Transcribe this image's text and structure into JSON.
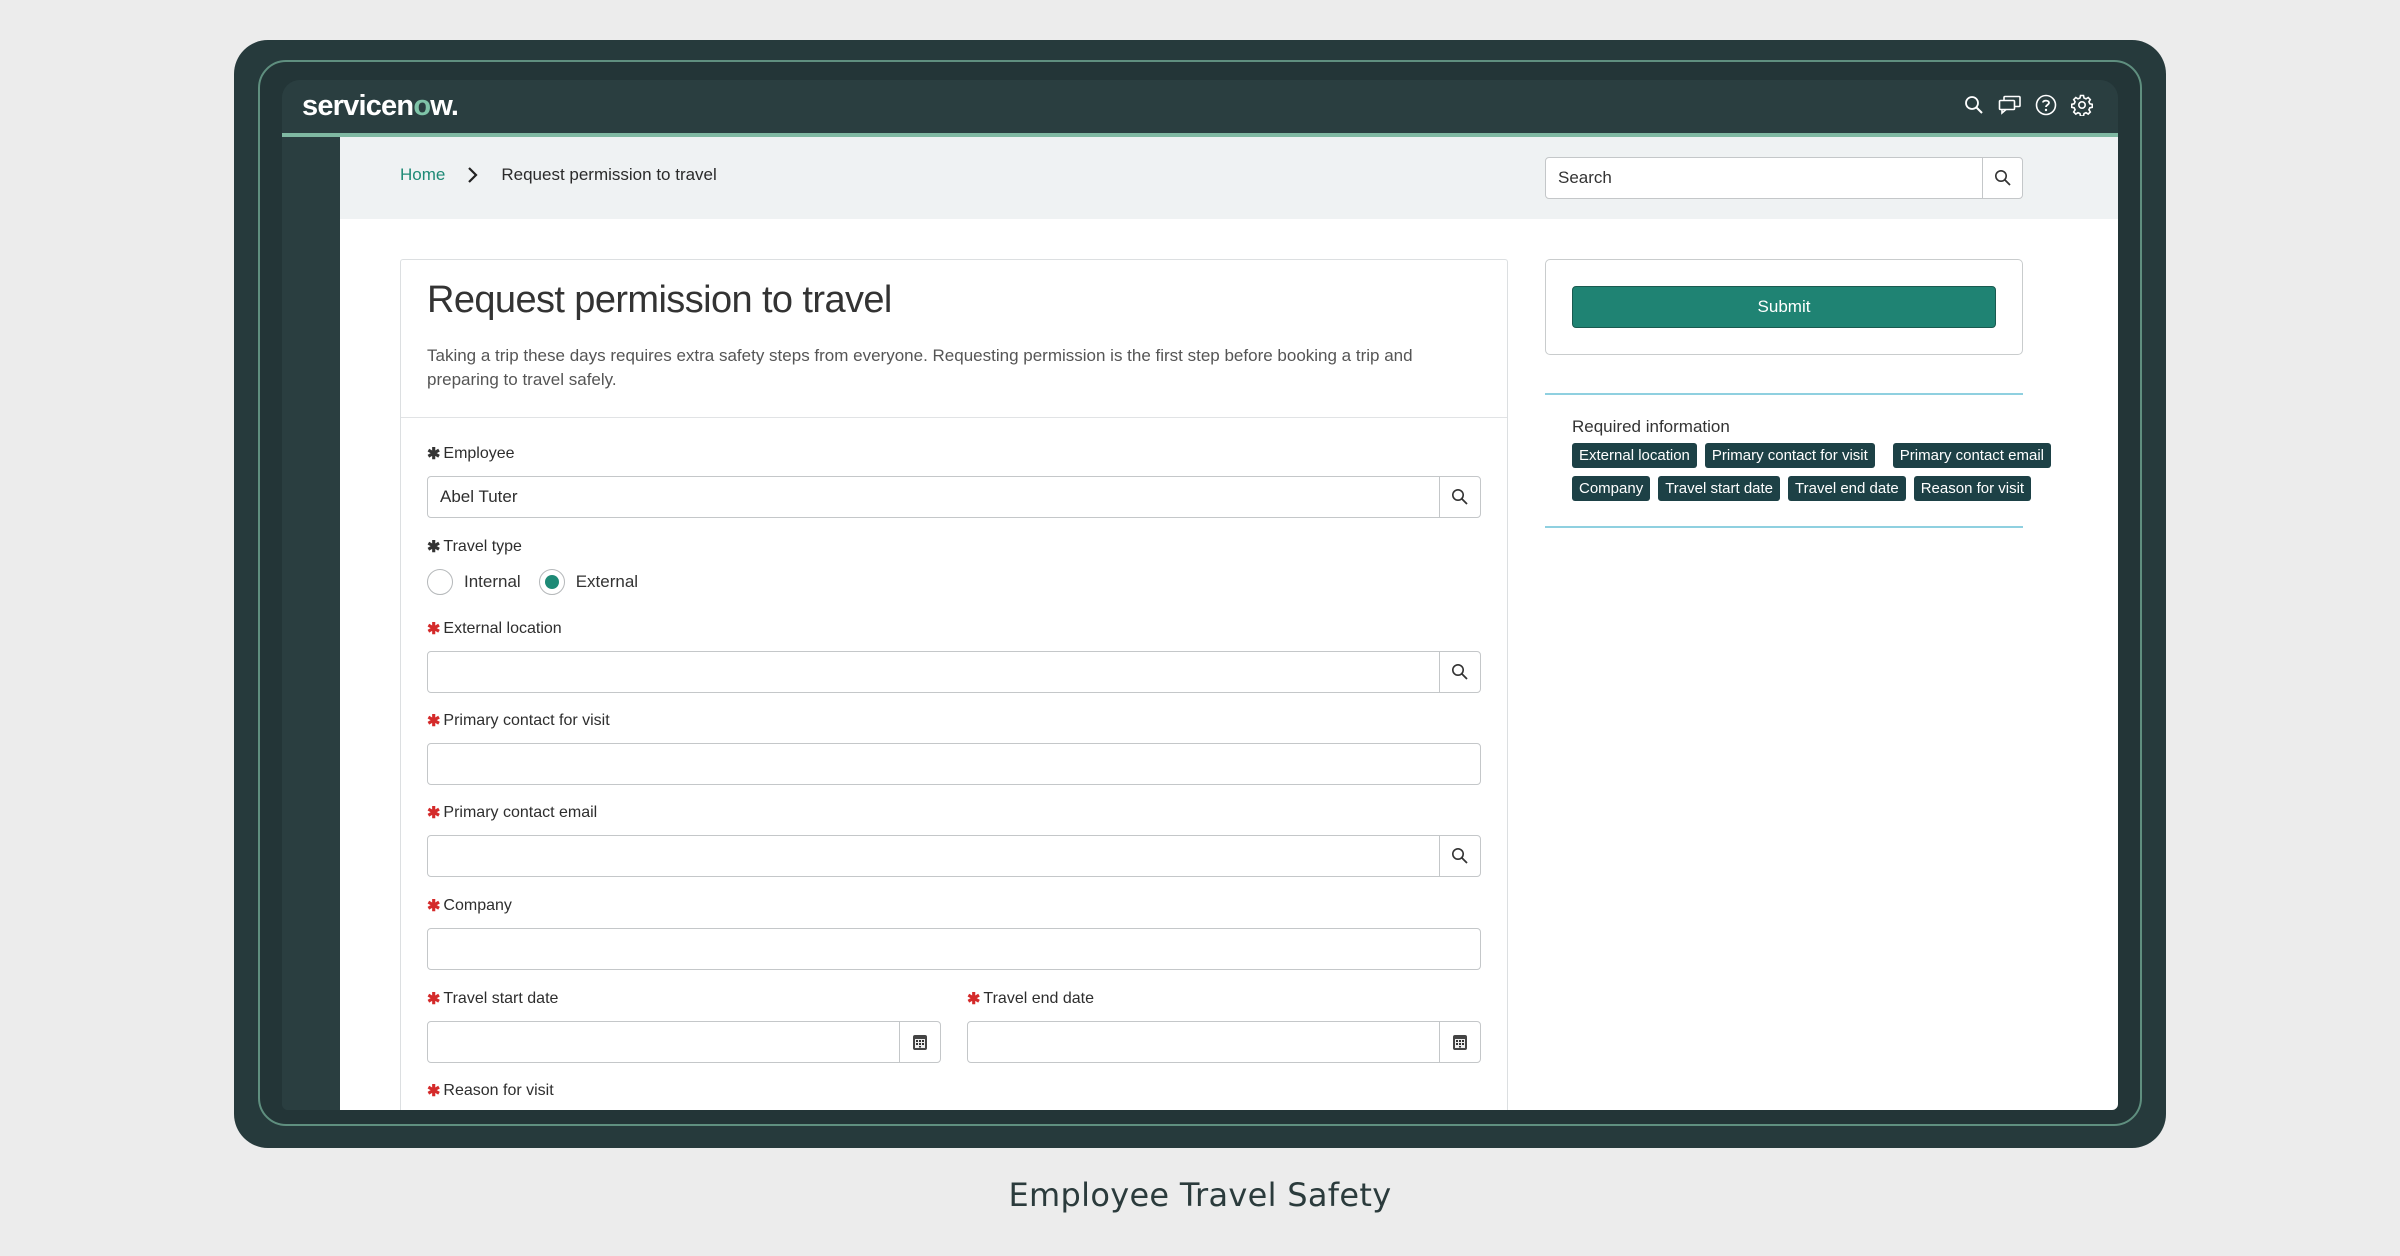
{
  "app": {
    "logo_prefix": "servicen",
    "logo_o": "o",
    "logo_suffix": "w.",
    "top_icons": [
      "search-icon",
      "chat-icon",
      "help-icon",
      "gear-icon"
    ]
  },
  "breadcrumb": {
    "home": "Home",
    "separator_icon": "chevron-right-icon",
    "current": "Request permission to travel"
  },
  "search": {
    "placeholder": "Search",
    "icon": "search-icon"
  },
  "form": {
    "title": "Request permission to travel",
    "description": "Taking a trip these days requires extra safety steps from everyone. Requesting permission is the first step before booking a trip and preparing to travel safely.",
    "fields": {
      "employee": {
        "label": "Employee",
        "value": "Abel Tuter",
        "required_mark": "✱",
        "addon_icon": "search-icon"
      },
      "travel_type": {
        "label": "Travel type",
        "required_mark": "✱",
        "options": [
          {
            "label": "Internal",
            "selected": false
          },
          {
            "label": "External",
            "selected": true
          }
        ]
      },
      "external_location": {
        "label": "External location",
        "value": "",
        "required_mark": "✱",
        "addon_icon": "search-icon"
      },
      "primary_contact": {
        "label": "Primary contact for visit",
        "value": "",
        "required_mark": "✱"
      },
      "primary_contact_email": {
        "label": "Primary contact email",
        "value": "",
        "required_mark": "✱",
        "addon_icon": "search-icon"
      },
      "company": {
        "label": "Company",
        "value": "",
        "required_mark": "✱"
      },
      "travel_start_date": {
        "label": "Travel start date",
        "value": "",
        "required_mark": "✱",
        "addon_icon": "calendar-icon"
      },
      "travel_end_date": {
        "label": "Travel end date",
        "value": "",
        "required_mark": "✱",
        "addon_icon": "calendar-icon"
      },
      "reason_for_visit": {
        "label": "Reason for visit",
        "required_mark": "✱"
      }
    }
  },
  "sidebar": {
    "submit_label": "Submit",
    "required_title": "Required information",
    "required_tags": [
      "External location",
      "Primary contact for visit",
      "Primary contact email",
      "Company",
      "Travel start date",
      "Travel end date",
      "Reason for visit"
    ]
  },
  "colors": {
    "brand_dark": "#263a3c",
    "accent_green": "#1f8373",
    "tag_bg": "#1d4146",
    "required_red": "#d42a2a",
    "divider_blue": "#8fd0e0"
  },
  "caption": "Employee Travel Safety"
}
